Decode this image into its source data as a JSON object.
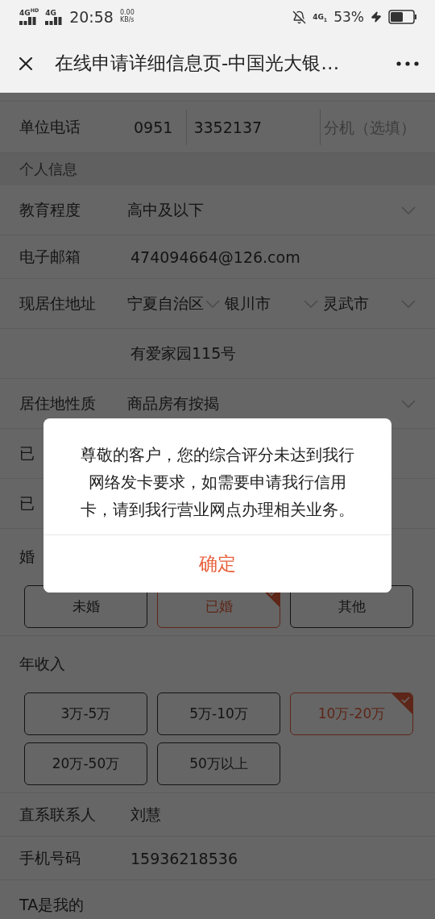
{
  "status_bar": {
    "signals": [
      "4G$^{HD}$",
      "4G"
    ],
    "time": "20:58",
    "speed": "0.00",
    "speed_unit": "KB/s",
    "data_network": "4G$_{1}$",
    "battery": "53%"
  },
  "nav": {
    "title": "在线申请详细信息页-中国光大银…"
  },
  "form": [
    {
      "kind": "phone",
      "label": "单位电话",
      "area": "0951",
      "number": "3352137",
      "extension_placeholder": "分机（选填）"
    },
    {
      "kind": "section",
      "label": "个人信息"
    },
    {
      "kind": "select",
      "label": "教育程度",
      "value": "高中及以下"
    },
    {
      "kind": "text",
      "label": "电子邮箱",
      "value": "474094664@126.com"
    },
    {
      "kind": "address",
      "label": "现居住地址",
      "province": "宁夏自治区",
      "city": "银川市",
      "county": "灵武市"
    },
    {
      "kind": "address_detail",
      "value": "有爱家园115号"
    },
    {
      "kind": "select",
      "label": "居住地性质",
      "value": "商品房有按揭"
    },
    {
      "kind": "text",
      "label": "已"
    },
    {
      "kind": "text",
      "label": "已"
    },
    {
      "kind": "choice",
      "label": "婚",
      "options": [
        {
          "label": "未婚",
          "selected": false
        },
        {
          "label": "已婚",
          "selected": true
        },
        {
          "label": "其他",
          "selected": false
        }
      ]
    },
    {
      "kind": "choice",
      "label": "年收入",
      "options": [
        {
          "label": "3万-5万",
          "selected": false
        },
        {
          "label": "5万-10万",
          "selected": false
        },
        {
          "label": "10万-20万",
          "selected": true
        },
        {
          "label": "20万-50万",
          "selected": false
        },
        {
          "label": "50万以上",
          "selected": false
        }
      ]
    },
    {
      "kind": "text",
      "label": "直系联系人",
      "value": "刘慧"
    },
    {
      "kind": "text",
      "label": "手机号码",
      "value": "15936218536"
    },
    {
      "kind": "text",
      "label": "TA是我的"
    }
  ],
  "dialog": {
    "message": "尊敬的客户，您的综合评分未达到我行网络发卡要求，如需要申请我行信用卡，请到我行营业网点办理相关业务。",
    "confirm": "确定"
  }
}
